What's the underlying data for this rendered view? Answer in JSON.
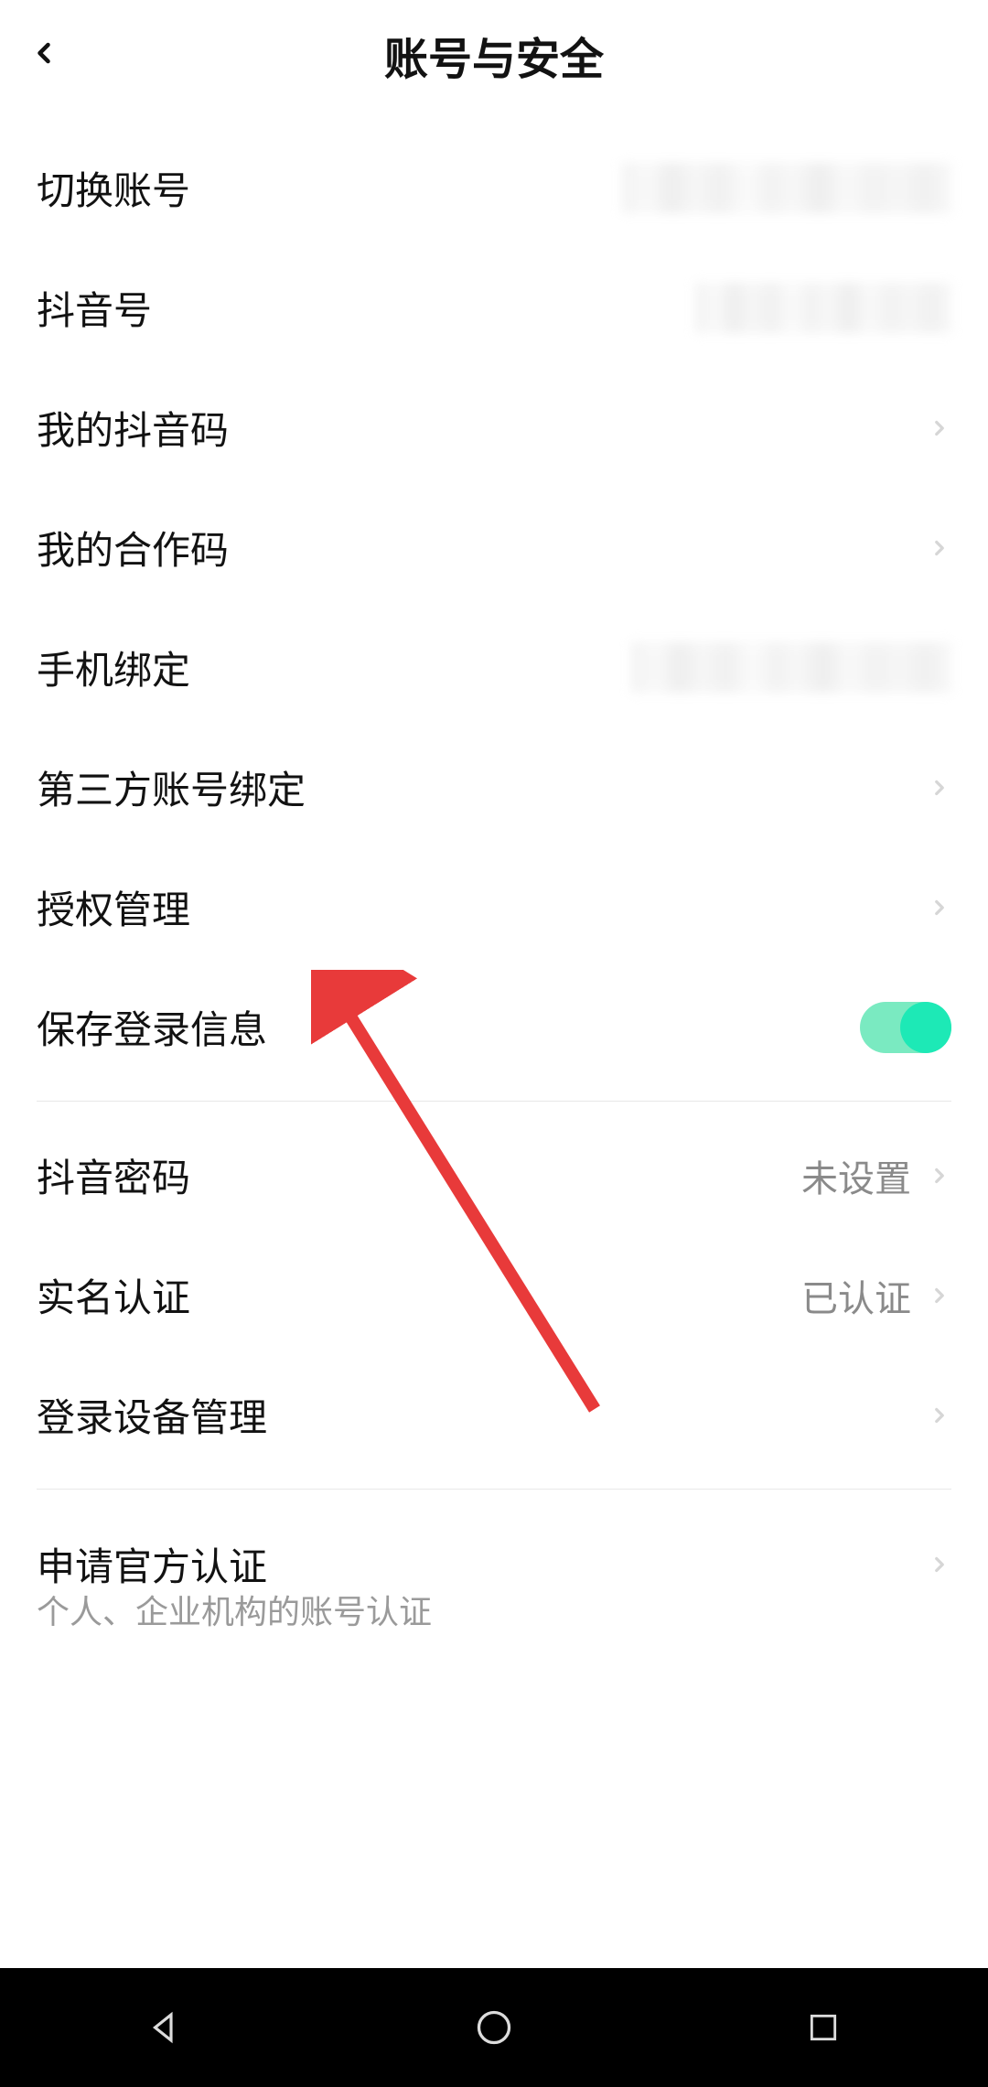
{
  "header": {
    "title": "账号与安全"
  },
  "items": {
    "switch_account": "切换账号",
    "douyin_id": "抖音号",
    "my_qr": "我的抖音码",
    "my_partner_code": "我的合作码",
    "phone_binding": "手机绑定",
    "third_party": "第三方账号绑定",
    "auth_mgmt": "授权管理",
    "save_login": "保存登录信息",
    "password": "抖音密码",
    "password_value": "未设置",
    "realname": "实名认证",
    "realname_value": "已认证",
    "device_mgmt": "登录设备管理",
    "official_cert": "申请官方认证",
    "official_cert_sub": "个人、企业机构的账号认证"
  }
}
